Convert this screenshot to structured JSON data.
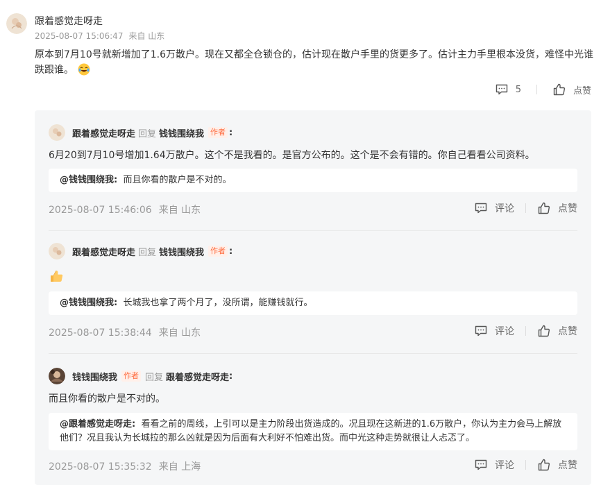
{
  "main": {
    "user": "跟着感觉走呀走",
    "time": "2025-08-07 15:06:47",
    "location": "来自 山东",
    "text": "原本到7月10号就新增加了1.6万散户。现在又都全仓锁仓的，估计现在散户手里的货更多了。估计主力手里根本没货，难怪中光谁跌跟谁。",
    "emoji": "laugh-cry-emoji",
    "comment_count": "5",
    "like_label": "点赞"
  },
  "replies": [
    {
      "user": "跟着感觉走呀走",
      "reply_word": "回复",
      "target": "钱钱围绕我",
      "tag": "作者",
      "colon": ":",
      "text": "6月20到7月10号增加1.64万散户。这个不是我看的。是官方公布的。这个是不会有错的。你自己看看公司资料。",
      "quote_user": "@钱钱围绕我:",
      "quote_text": "而且你看的散户是不对的。",
      "time": "2025-08-07 15:46:06",
      "location": "来自 山东",
      "comment_label": "评论",
      "like_label": "点赞"
    },
    {
      "user": "跟着感觉走呀走",
      "reply_word": "回复",
      "target": "钱钱围绕我",
      "tag": "作者",
      "colon": ":",
      "text": "",
      "emoji": "thumbs-up-emoji",
      "quote_user": "@钱钱围绕我:",
      "quote_text": "长城我也拿了两个月了，没所谓，能赚钱就行。",
      "time": "2025-08-07 15:38:44",
      "location": "来自 山东",
      "comment_label": "评论",
      "like_label": "点赞"
    },
    {
      "user": "钱钱围绕我",
      "tag": "作者",
      "reply_word": "回复",
      "target": "跟着感觉走呀走",
      "colon": ":",
      "text": "而且你看的散户是不对的。",
      "quote_user": "@跟着感觉走呀走:",
      "quote_text": "看看之前的周线，上引可以是主力阶段出货造成的。况且现在这新进的1.6万散户，你认为主力会马上解放他们？况且我认为长城拉的那么凶就是因为后面有大利好不怕难出货。而中光这种走势就很让人忐忑了。",
      "time": "2025-08-07 15:35:32",
      "location": "来自 上海",
      "comment_label": "评论",
      "like_label": "点赞"
    }
  ],
  "colors": {
    "author_tag": "#ff6a3d",
    "reply_bg": "#f5f6f7",
    "meta": "#999999"
  }
}
